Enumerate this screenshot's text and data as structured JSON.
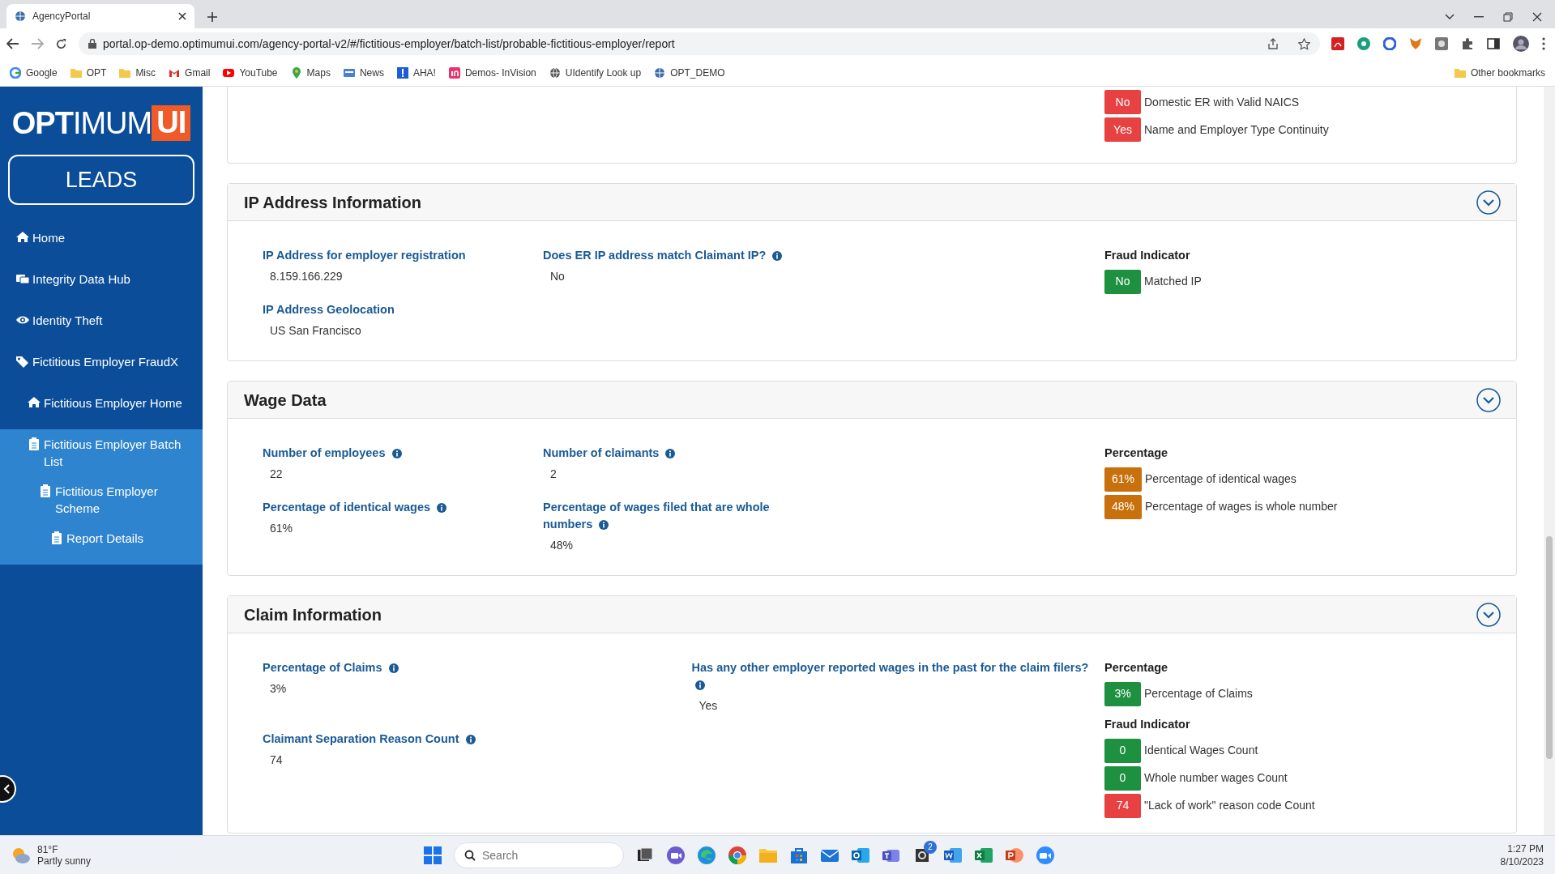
{
  "browser": {
    "tab_title": "AgencyPortal",
    "url": "portal.op-demo.optimumui.com/agency-portal-v2/#/fictitious-employer/batch-list/probable-fictitious-employer/report",
    "bookmarks": [
      {
        "label": "Google"
      },
      {
        "label": "OPT"
      },
      {
        "label": "Misc"
      },
      {
        "label": "Gmail"
      },
      {
        "label": "YouTube"
      },
      {
        "label": "Maps"
      },
      {
        "label": "News"
      },
      {
        "label": "AHA!"
      },
      {
        "label": "Demos- InVision"
      },
      {
        "label": "UIdentify Look up"
      },
      {
        "label": "OPT_DEMO"
      }
    ],
    "other_bookmarks": "Other bookmarks"
  },
  "sidebar": {
    "logo": {
      "part1": "OPT",
      "part2": "IMUM",
      "part3": "UI"
    },
    "leads_button": "LEADS",
    "items": [
      {
        "label": "Home",
        "selected": false
      },
      {
        "label": "Integrity Data Hub",
        "selected": false
      },
      {
        "label": "Identity Theft",
        "selected": false
      },
      {
        "label": "Fictitious Employer FraudX",
        "selected": false,
        "children": [
          {
            "label": "Fictitious Employer Home",
            "selected": false
          },
          {
            "label": "Fictitious Employer Batch List",
            "selected": true,
            "children": [
              {
                "label": "Fictitious Employer Scheme",
                "selected": true,
                "children": [
                  {
                    "label": "Report Details",
                    "selected": true
                  }
                ]
              }
            ]
          }
        ]
      }
    ]
  },
  "cards": [
    {
      "groups": [
        {
          "items": [
            {
              "badge": "No",
              "color": "#e84142",
              "label": "Domestic ER with Valid NAICS"
            },
            {
              "badge": "Yes",
              "color": "#e84142",
              "label": "Name and Employer Type Continuity"
            }
          ]
        }
      ]
    },
    {
      "title": "IP Address Information",
      "fields": [
        {
          "label": "IP Address for employer registration",
          "info": false,
          "value": "8.159.166.229"
        },
        {
          "label": "Does ER IP address match Claimant IP?",
          "info": true,
          "value": "No"
        },
        {
          "label": "IP Address Geolocation",
          "info": false,
          "value": "US San Francisco"
        }
      ],
      "groups": [
        {
          "heading": "Fraud Indicator",
          "items": [
            {
              "badge": "No",
              "color": "#1e9141",
              "label": "Matched IP"
            }
          ]
        }
      ]
    },
    {
      "title": "Wage Data",
      "fields": [
        {
          "label": "Number of employees",
          "info": true,
          "value": "22"
        },
        {
          "label": "Number of claimants",
          "info": true,
          "value": "2"
        },
        {
          "label": "Percentage of identical wages",
          "info": true,
          "value": "61%"
        },
        {
          "label": "Percentage of wages filed that are whole numbers",
          "info": true,
          "value": "48%"
        }
      ],
      "groups": [
        {
          "heading": "Percentage",
          "items": [
            {
              "badge": "61%",
              "color": "#c8700c",
              "label": "Percentage of identical wages"
            },
            {
              "badge": "48%",
              "color": "#c8700c",
              "label": "Percentage of wages is whole number"
            }
          ]
        }
      ]
    },
    {
      "title": "Claim Information",
      "fields": [
        {
          "label": "Percentage of Claims",
          "info": true,
          "value": "3%"
        },
        {
          "label": "Has any other employer reported wages in the past for the claim filers?",
          "info": true,
          "value": "Yes"
        },
        {
          "label": "Claimant Separation Reason Count",
          "info": true,
          "value": "74"
        }
      ],
      "groups": [
        {
          "heading": "Percentage",
          "items": [
            {
              "badge": "3%",
              "color": "#1e9141",
              "label": "Percentage of Claims"
            }
          ]
        },
        {
          "heading": "Fraud Indicator",
          "items": [
            {
              "badge": "0",
              "color": "#1e9141",
              "label": "Identical Wages Count"
            },
            {
              "badge": "0",
              "color": "#1e9141",
              "label": "Whole number wages Count"
            },
            {
              "badge": "74",
              "color": "#e84142",
              "label": "\"Lack of work\" reason code Count"
            }
          ]
        }
      ]
    }
  ],
  "taskbar": {
    "weather_temp": "81°F",
    "weather_text": "Partly sunny",
    "search_placeholder": "Search",
    "notification_badge": "2",
    "time": "1:27 PM",
    "date": "8/10/2023"
  }
}
